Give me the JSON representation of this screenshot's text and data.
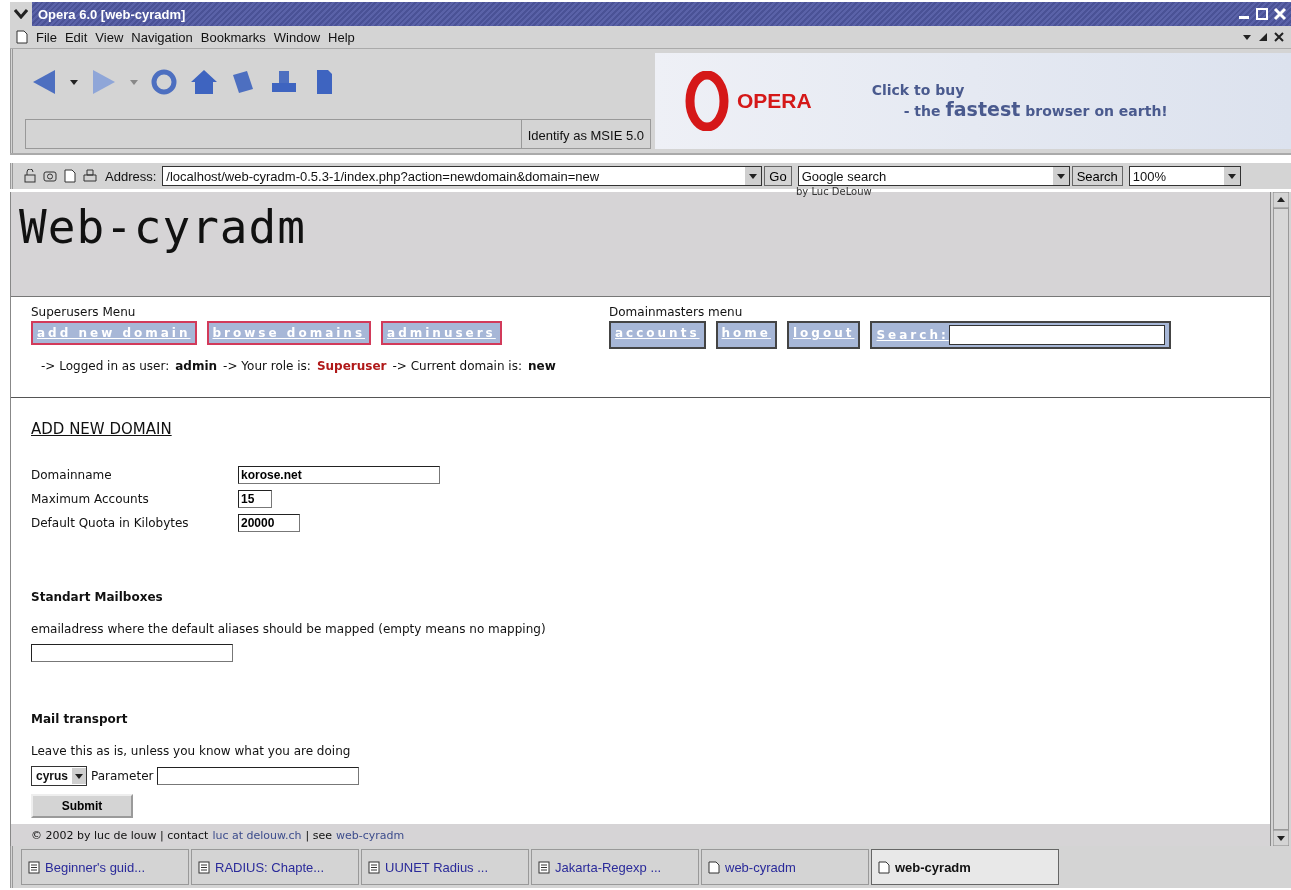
{
  "window": {
    "title": "Opera 6.0  [web-cyradm]"
  },
  "menu": [
    "File",
    "Edit",
    "View",
    "Navigation",
    "Bookmarks",
    "Window",
    "Help"
  ],
  "toolbar": {
    "identify": "Identify as MSIE 5.0"
  },
  "banner": {
    "brand": "OPERA",
    "line1": "Click to buy",
    "line2_start": "- the",
    "line2_big": "fastest",
    "line2_end": "browser on earth!"
  },
  "address": {
    "label": "Address:",
    "value": "/localhost/web-cyradm-0.5.3-1/index.php?action=newdomain&domain=new",
    "go": "Go",
    "search_value": "Google search",
    "search_button": "Search",
    "zoom": "100%"
  },
  "page": {
    "logo": "Web-cyradm",
    "byline": "by Luc DeLouw",
    "superusers_label": "Superusers Menu",
    "domainmasters_label": "Domainmasters menu",
    "super_buttons": [
      {
        "label": "add new domain"
      },
      {
        "label": "browse domains"
      },
      {
        "label": "adminusers"
      }
    ],
    "domain_buttons": [
      {
        "label": "accounts"
      },
      {
        "label": "home"
      },
      {
        "label": "logout"
      }
    ],
    "search_label": "Search:",
    "status": [
      {
        "text": "-> Logged in as user:",
        "kind": "plain"
      },
      {
        "text": "admin",
        "kind": "strong"
      },
      {
        "text": "-> Your role is:",
        "kind": "plain"
      },
      {
        "text": "Superuser",
        "kind": "alert"
      },
      {
        "text": "-> Current domain is:",
        "kind": "plain"
      },
      {
        "text": "new",
        "kind": "strong"
      }
    ],
    "heading": "ADD NEW DOMAIN",
    "fields": [
      {
        "label": "Domainname",
        "value": "korose.net"
      },
      {
        "label": "Maximum Accounts",
        "value": "15"
      },
      {
        "label": "Default Quota in Kilobytes",
        "value": "20000"
      }
    ],
    "mailboxes_heading": "Standart Mailboxes",
    "mailboxes_hint": "emailadress where the default aliases should be mapped (empty means no mapping)",
    "transport_heading": "Mail transport",
    "transport_hint": "Leave this as is, unless you know what you are doing",
    "transport_value": "cyrus",
    "parameter_label": "Parameter",
    "submit": "Submit",
    "footer": [
      {
        "text": "© 2002 by luc de louw | contact",
        "kind": "plain"
      },
      {
        "text": "luc at delouw.ch",
        "kind": "link"
      },
      {
        "text": "| see",
        "kind": "plain"
      },
      {
        "text": "web-cyradm",
        "kind": "link"
      }
    ]
  },
  "tabs": [
    {
      "label": "Beginner's guid...",
      "kind": "doc",
      "selected": false
    },
    {
      "label": "RADIUS: Chapte...",
      "kind": "doc",
      "selected": false
    },
    {
      "label": "UUNET Radius ...",
      "kind": "doc",
      "selected": false
    },
    {
      "label": "Jakarta-Regexp ...",
      "kind": "doc",
      "selected": false
    },
    {
      "label": "web-cyradm",
      "kind": "page",
      "selected": false
    },
    {
      "label": "web-cyradm",
      "kind": "page",
      "selected": true
    }
  ]
}
